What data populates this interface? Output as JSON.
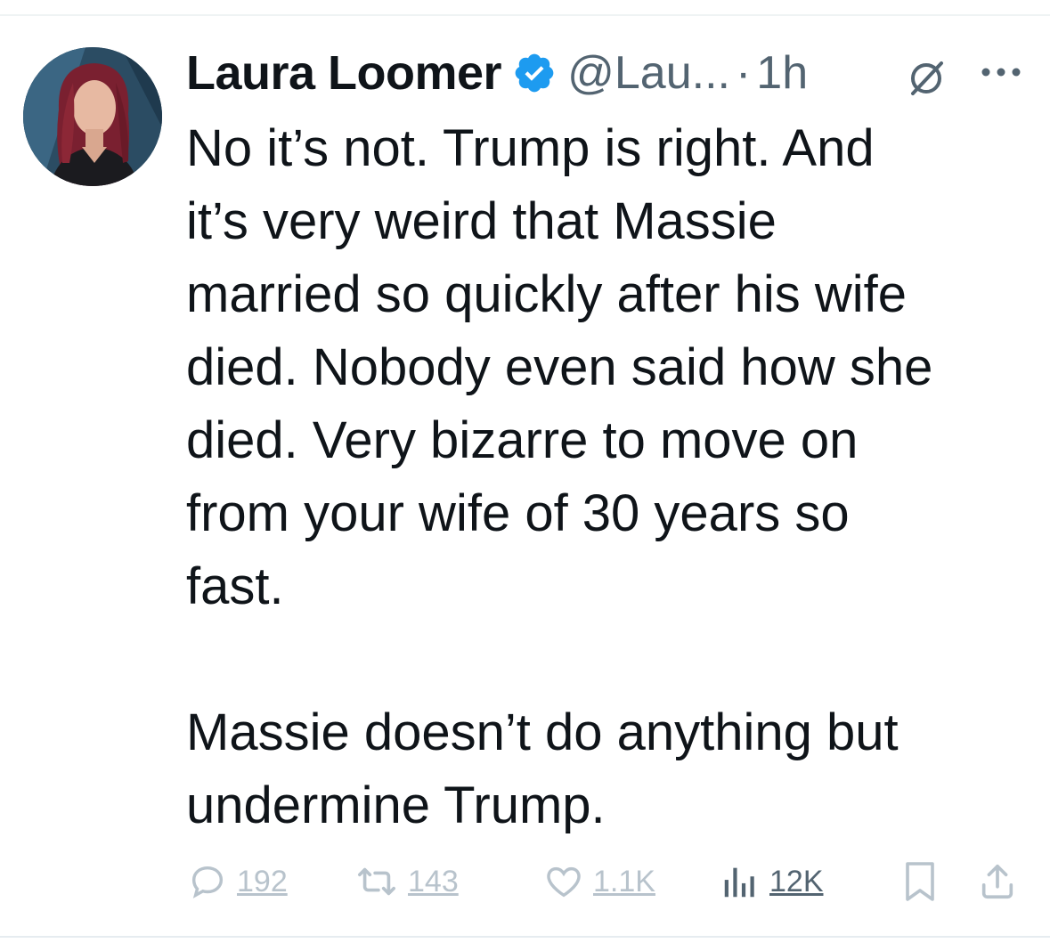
{
  "tweet": {
    "author": {
      "display_name": "Laura Loomer",
      "handle": "@Lau...",
      "verified": true
    },
    "time_separator": "·",
    "time": "1h",
    "text_lines": [
      "No it’s not. Trump is right. And",
      "it’s very weird that Massie",
      "married so quickly after his wife",
      "died. Nobody even said how she",
      "died. Very bizarre to move on",
      "from your wife of 30 years so",
      "fast.",
      "",
      "Massie doesn’t do anything but",
      "undermine Trump."
    ]
  },
  "actions": {
    "replies": "192",
    "reposts": "143",
    "likes": "1.1K",
    "views": "12K"
  },
  "icons": {
    "verified": "verified-badge-icon",
    "grok": "grok-icon",
    "more": "more-options-icon",
    "reply": "reply-icon",
    "repost": "repost-icon",
    "like": "heart-icon",
    "views": "views-chart-icon",
    "bookmark": "bookmark-icon",
    "share": "share-icon"
  },
  "colors": {
    "verified_blue": "#1d9bf0",
    "text_primary": "#0f1419",
    "text_secondary": "#536471",
    "action_faded": "#b8c3cc"
  }
}
